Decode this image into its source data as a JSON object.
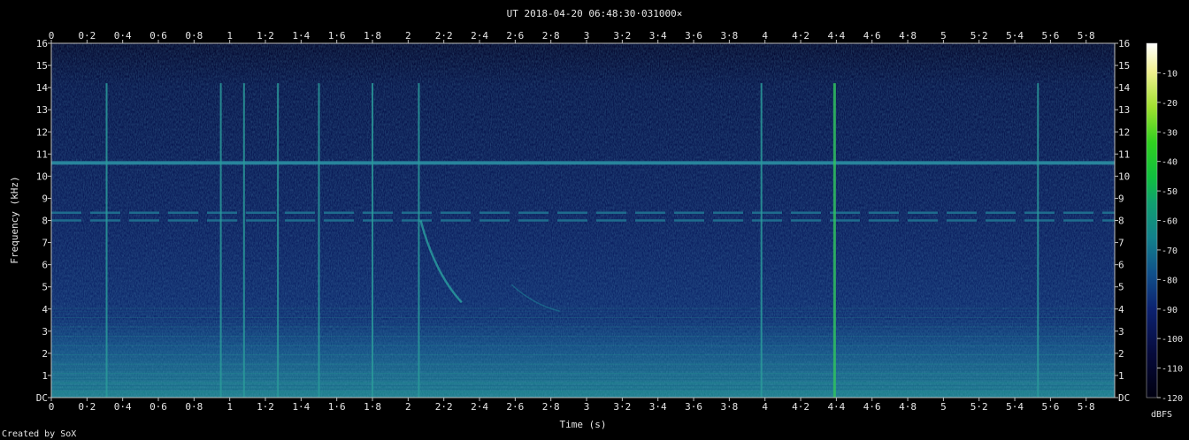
{
  "chart_data": {
    "type": "heatmap",
    "title": "UT 2018-04-20 06:48:30·031000×",
    "xlabel": "Time (s)",
    "ylabel": "Frequency (kHz)",
    "xlim": [
      0,
      5.96
    ],
    "ylim": [
      0,
      16
    ],
    "x_ticks": [
      "0",
      "0·2",
      "0·4",
      "0·6",
      "0·8",
      "1",
      "1·2",
      "1·4",
      "1·6",
      "1·8",
      "2",
      "2·2",
      "2·4",
      "2·6",
      "2·8",
      "3",
      "3·2",
      "3·4",
      "3·6",
      "3·8",
      "4",
      "4·2",
      "4·4",
      "4·6",
      "4·8",
      "5",
      "5·2",
      "5·4",
      "5·6",
      "5·8"
    ],
    "x_tick_values": [
      0,
      0.2,
      0.4,
      0.6,
      0.8,
      1.0,
      1.2,
      1.4,
      1.6,
      1.8,
      2.0,
      2.2,
      2.4,
      2.6,
      2.8,
      3.0,
      3.2,
      3.4,
      3.6,
      3.8,
      4.0,
      4.2,
      4.4,
      4.6,
      4.8,
      5.0,
      5.2,
      5.4,
      5.6,
      5.8
    ],
    "y_ticks": [
      "DC",
      "1",
      "2",
      "3",
      "4",
      "5",
      "6",
      "7",
      "8",
      "9",
      "10",
      "11",
      "12",
      "13",
      "14",
      "15",
      "16"
    ],
    "y_tick_values": [
      0,
      1,
      2,
      3,
      4,
      5,
      6,
      7,
      8,
      9,
      10,
      11,
      12,
      13,
      14,
      15,
      16
    ],
    "colorbar": {
      "label": "dBFS",
      "range": [
        -120,
        0
      ],
      "ticks": [
        "-10",
        "-20",
        "-30",
        "-40",
        "-50",
        "-60",
        "-70",
        "-80",
        "-90",
        "-100",
        "-110",
        "-120"
      ],
      "tick_values": [
        -10,
        -20,
        -30,
        -40,
        -50,
        -60,
        -70,
        -80,
        -90,
        -100,
        -110,
        -120
      ]
    },
    "narrowband_lines_khz": [
      10.6,
      8.35,
      8.0
    ],
    "impulse_times_s": [
      0.31,
      0.95,
      1.08,
      1.27,
      1.5,
      1.8,
      2.06,
      3.98,
      4.39,
      5.53
    ],
    "grid": false,
    "footer": "Created by SoX"
  }
}
